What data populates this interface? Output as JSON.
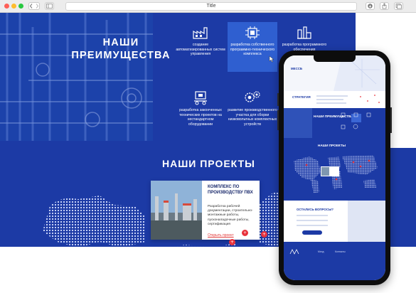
{
  "browser": {
    "title": "Title",
    "colors": {
      "close": "#fe5f57",
      "minimize": "#febc2e",
      "maximize": "#28c840"
    },
    "icons": [
      "back-arrow-icon",
      "forward-arrow-icon",
      "sidebar-icon",
      "download-icon",
      "share-icon",
      "new-tab-icon"
    ]
  },
  "advantages": {
    "heading_line1": "НАШИ",
    "heading_line2": "ПРЕИМУЩЕСТВА",
    "items": [
      {
        "text": "создание автоматизированных систем управления",
        "icon": "factory-icon"
      },
      {
        "text": "разработка собственного программно-технического комплекса",
        "icon": "circuit-board-icon"
      },
      {
        "text": "разработка программного обеспечения",
        "icon": "industrial-plant-icon"
      },
      {
        "text": "разработка законченных технических проектов на нестандартном оборудовании",
        "icon": "robot-cart-icon"
      },
      {
        "text": "развитие производственного участка для сборки низковольтных комплектных устройств",
        "icon": "gears-icon"
      }
    ]
  },
  "projects": {
    "heading": "НАШИ ПРОЕКТЫ",
    "card": {
      "title": "КОМПЛЕКС ПО ПРОИЗВОДСТВУ ПВХ",
      "text": "Разработка рабочей документации, строительно-монтажные работы, пусконаладочные работы, сертификация",
      "link": "Открыть проект"
    },
    "pin_label": "+"
  },
  "mobile": {
    "strategy": "СТРАТЕГИЯ",
    "advantages": "НАШИ ПРЕИМУЩЕСТВА",
    "projects": "НАШИ ПРОЕКТЫ",
    "questions": "ОСТАЛИСЬ ВОПРОСЫ?",
    "nav1": "МЕССБ",
    "nav2": "Мэнд",
    "nav3": "Контакты"
  },
  "colors": {
    "primary_blue": "#1c3aa5",
    "active_tile": "#2f5fd0",
    "accent_red": "#e8323c"
  }
}
